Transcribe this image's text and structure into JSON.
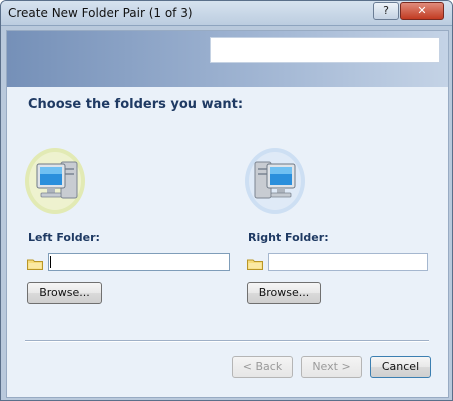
{
  "window": {
    "title": "Create New Folder Pair (1 of 3)",
    "help_label": "?",
    "close_label": "✕"
  },
  "header": {
    "heading": "Choose the folders you want:"
  },
  "left": {
    "label": "Left Folder:",
    "input_value": "",
    "browse_label": "Browse..."
  },
  "right": {
    "label": "Right Folder:",
    "input_value": "",
    "browse_label": "Browse..."
  },
  "footer": {
    "back_label": "< Back",
    "next_label": "Next >",
    "cancel_label": "Cancel"
  },
  "colors": {
    "heading": "#1f3a63",
    "header_band": "#7590b8",
    "client_bg": "#eaf1f9",
    "left_icon_halo": "#e4ecb8",
    "right_icon_halo": "#cfe0f3"
  },
  "icons": {
    "left_computer": "computer-icon",
    "right_computer": "computer-icon",
    "folder": "folder-icon"
  }
}
